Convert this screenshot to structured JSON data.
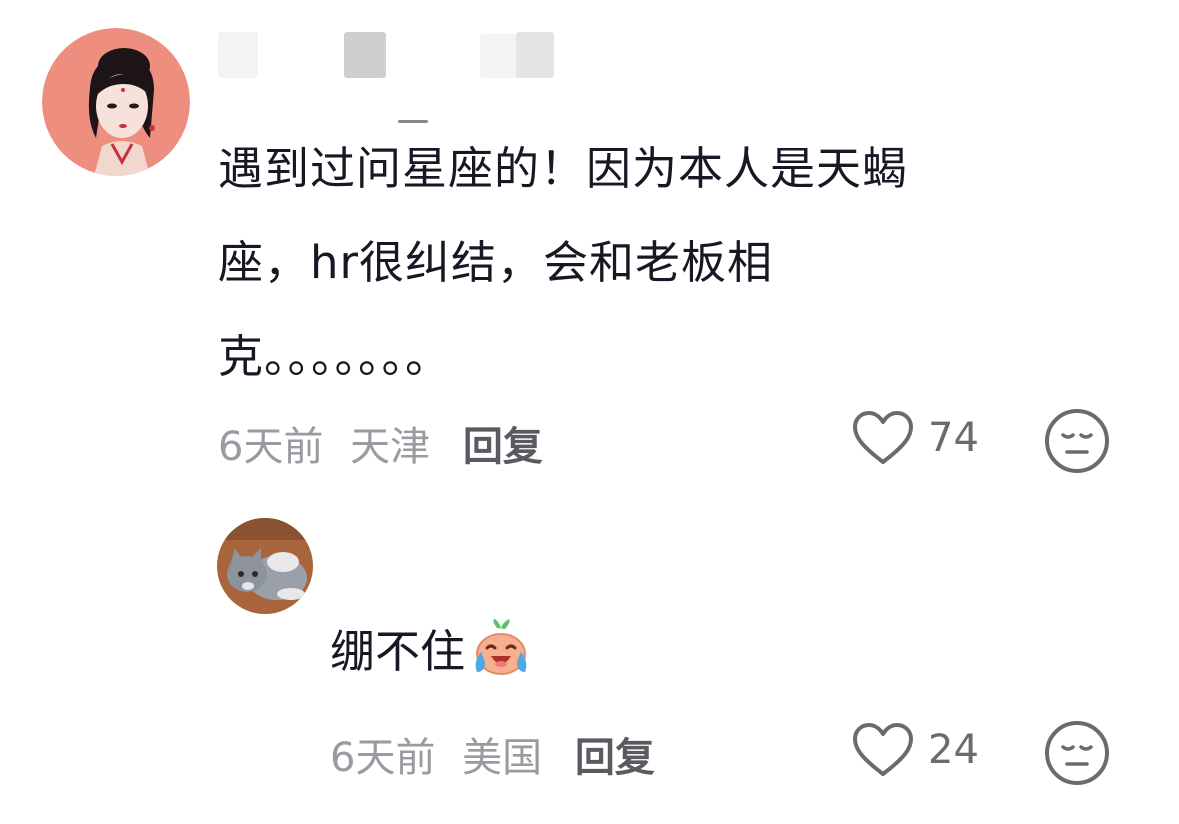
{
  "comment": {
    "lines": [
      "遇到过问星座的！因为本人是天蝎",
      "座，hr很纠结，会和老板相",
      "克。。。。。。。"
    ],
    "time": "6天前",
    "location": "天津",
    "reply_label": "回复",
    "likes": "74",
    "avatar_icon": "woman-portrait-avatar"
  },
  "reply": {
    "text": "绷不住",
    "emoji_icon": "crying-laughing-face-icon",
    "time": "6天前",
    "location": "美国",
    "reply_label": "回复",
    "likes": "24",
    "avatar_icon": "gray-cat-avatar"
  },
  "colors": {
    "text": "#161823",
    "meta": "#9a9aa0",
    "avatar_bg": "#ee8e7e"
  }
}
